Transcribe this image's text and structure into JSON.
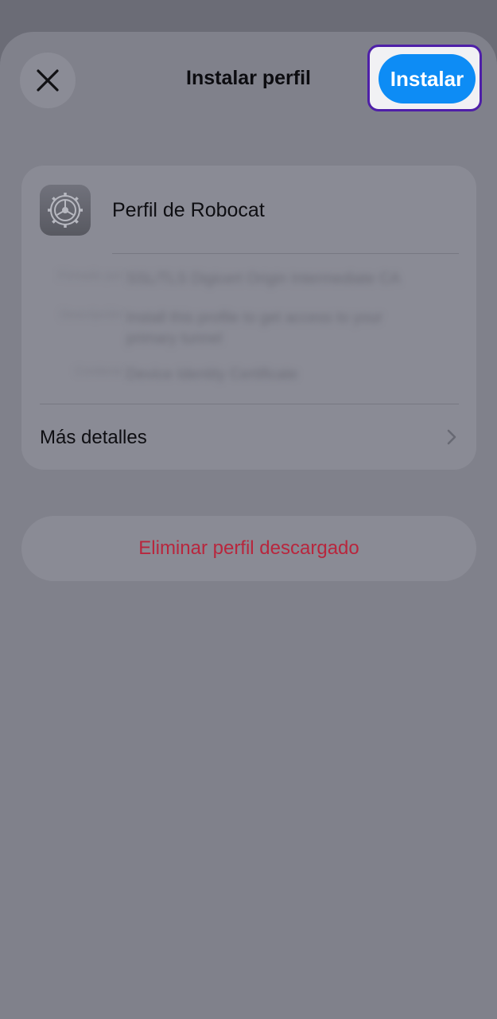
{
  "header": {
    "title": "Instalar perfil",
    "install_label": "Instalar",
    "close_icon": "close-icon"
  },
  "profile": {
    "icon": "gear-icon",
    "name": "Perfil de Robocat",
    "details": [
      {
        "label": "Firmado por",
        "value": "SSL/TLS Digicert Origin Intermediate CA"
      },
      {
        "label": "Descripción",
        "value": "Install this profile to get access to your primary tunnel"
      },
      {
        "label": "Contiene",
        "value": "Device Identity Certificate"
      }
    ],
    "more_label": "Más detalles",
    "chevron_icon": "chevron-right-icon"
  },
  "actions": {
    "delete_label": "Eliminar perfil descargado"
  },
  "colors": {
    "accent": "#0d8cf5",
    "destructive": "#b8263d",
    "highlight_border": "#4e1fa8"
  }
}
